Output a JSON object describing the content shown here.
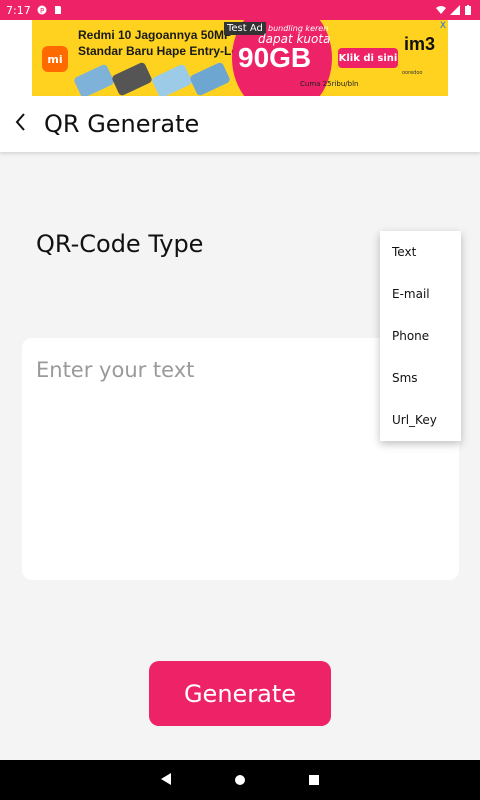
{
  "status_bar": {
    "time": "7:17",
    "icons": [
      "p-icon",
      "sd-card-icon",
      "wifi-icon",
      "signal-icon",
      "battery-icon"
    ]
  },
  "ad": {
    "badge": "Test Ad",
    "brand_logo": "mi",
    "headline_1": "Redmi 10 Jagoannya 50MP",
    "headline_2": "Standar Baru Hape Entry-Level",
    "promo_1": "bundling keren",
    "promo_2": "dapat kuota",
    "promo_big": "90GB",
    "price_note": "Cuma 25ribu/bln",
    "cta": "Klik di sini",
    "operator": "im3",
    "operator_sub": "ooredoo",
    "close": "X"
  },
  "toolbar": {
    "title": "QR Generate"
  },
  "form": {
    "type_label": "QR-Code Type",
    "input_placeholder": "Enter your text",
    "input_value": ""
  },
  "menu": {
    "items": [
      "Text",
      "E-mail",
      "Phone",
      "Sms",
      "Url_Key"
    ]
  },
  "actions": {
    "generate_label": "Generate"
  },
  "colors": {
    "accent": "#ee2266",
    "background": "#f4f4f4",
    "card": "#ffffff"
  }
}
